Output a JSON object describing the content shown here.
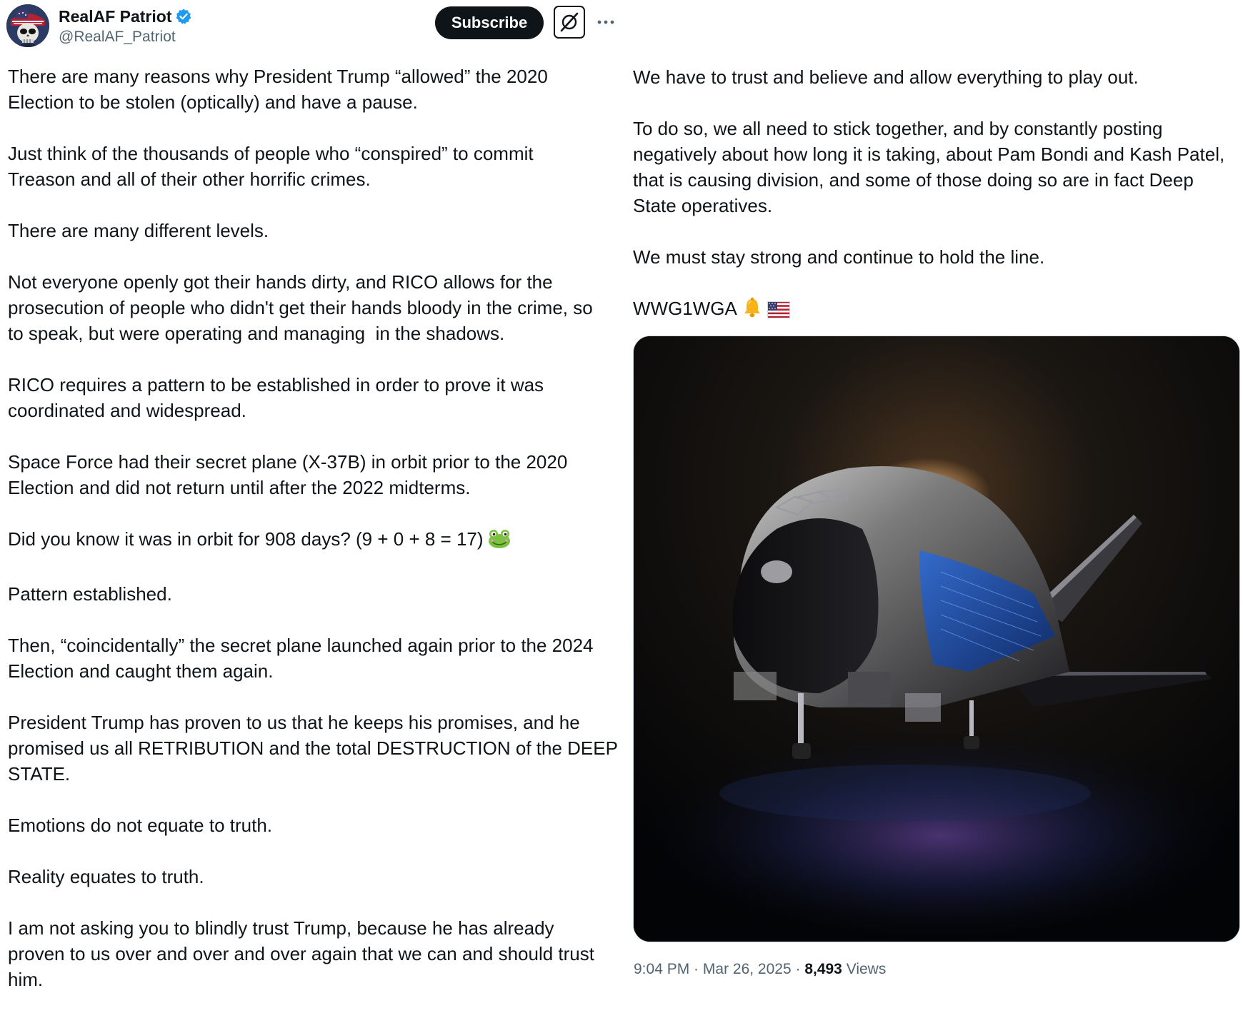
{
  "author": {
    "display_name": "RealAF Patriot",
    "handle": "@RealAF_Patriot",
    "verified": true,
    "verified_color": "#1d9bf0"
  },
  "header": {
    "subscribe_label": "Subscribe",
    "grok_icon": "grok-icon",
    "more_icon": "more-icon"
  },
  "post": {
    "left_paragraphs": [
      "There are many reasons why President Trump “allowed” the 2020\nElection to be stolen (optically) and have a pause.",
      "Just think of the thousands of people who “conspired” to commit\nTreason and all of their other horrific crimes.",
      "There are many different levels.",
      "Not everyone openly got their hands dirty, and RICO allows for the\nprosecution of people who didn't get their hands bloody in the crime, so\nto speak, but were operating and managing  in the shadows.",
      "RICO requires a pattern to be established in order to prove it was\ncoordinated and widespread.",
      "Space Force had their secret plane (X-37B) in orbit prior to the 2020\nElection and did not return until after the 2022 midterms.",
      "Did you know it was in orbit for 908 days? (9 + 0 + 8 = 17)",
      "Pattern established.",
      "Then, “coincidentally” the secret plane launched again prior to the 2024\nElection and caught them again.",
      "President Trump has proven to us that he keeps his promises, and he\npromised us all RETRIBUTION and the total DESTRUCTION of the DEEP\nSTATE.",
      "Emotions do not equate to truth.",
      "Reality equates to truth.",
      "I am not asking you to blindly trust Trump, because he has already\nproven to us over and over and over again that we can and should trust\nhim."
    ],
    "right_paragraphs": [
      "We have to trust and believe and allow everything to play out.",
      "To do so, we all need to stick together, and by constantly posting\nnegatively about how long it is taking, about Pam Bondi and Kash Patel,\nthat is causing division, and some of those doing so are in fact Deep\nState operatives.",
      "We must stay strong and continue to hold the line.",
      "WWG1WGA"
    ],
    "emojis": {
      "frog": "frog-emoji",
      "bell": "bell-emoji",
      "flag": "us-flag-emoji"
    },
    "media_alt": "X-37B spaceplane in dark hangar"
  },
  "meta": {
    "time": "9:04 PM",
    "separator": " · ",
    "date": "Mar 26, 2025",
    "views_count": "8,493",
    "views_label": " Views"
  }
}
